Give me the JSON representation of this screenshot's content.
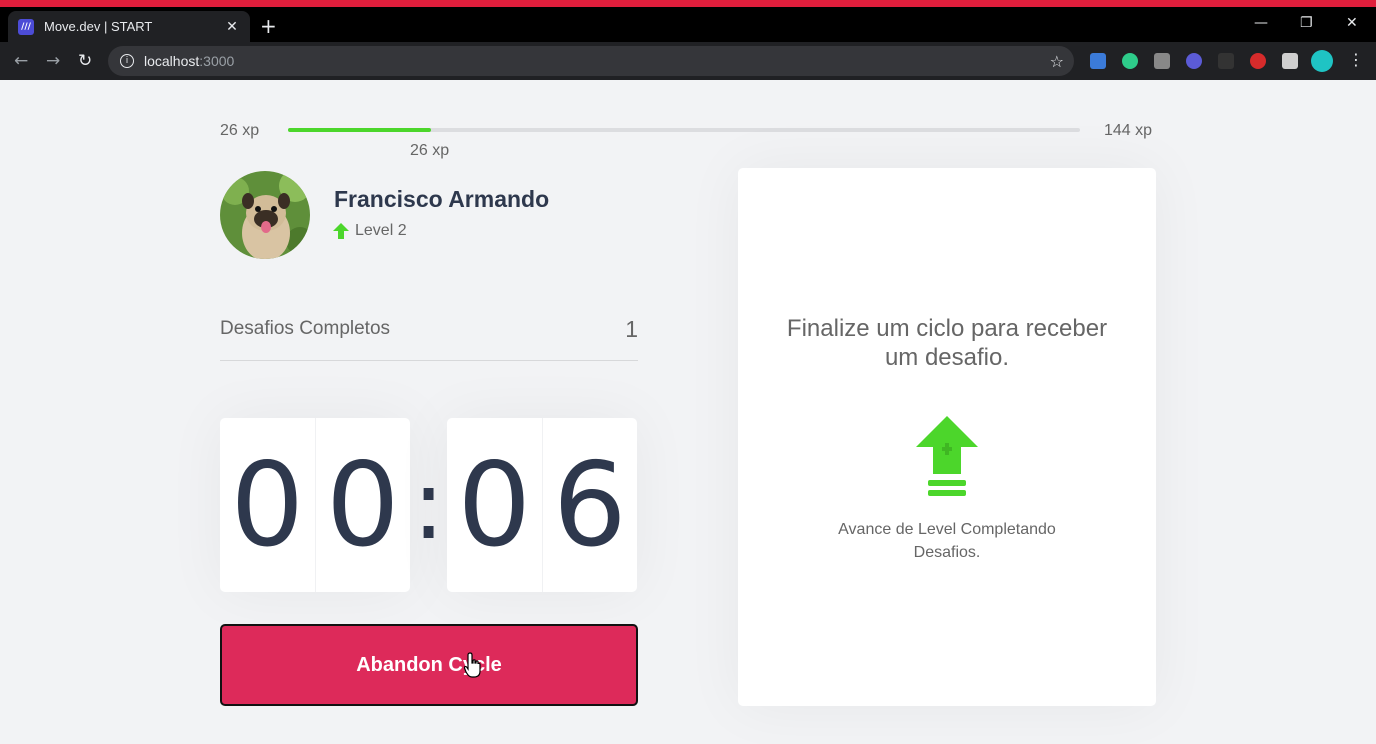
{
  "browser": {
    "tab_title": "Move.dev | START",
    "favicon_text": "///",
    "url_host": "localhost",
    "url_port": ":3000",
    "new_tab": "+",
    "tab_close": "✕",
    "window_controls": {
      "minimize": "—",
      "restore": "❐",
      "close": "✕"
    },
    "nav": {
      "back": "←",
      "forward": "→",
      "reload": "↻"
    },
    "info_icon": "i",
    "star": "☆",
    "menu": "⋮"
  },
  "experience": {
    "min_label": "26 xp",
    "max_label": "144 xp",
    "current_label": "26 xp",
    "progress": 0.18,
    "fill_color": "#4cd62b"
  },
  "profile": {
    "name": "Francisco Armando",
    "level": "Level 2",
    "level_icon": "level-up-arrow-icon"
  },
  "challenges_completed": {
    "label": "Desafios Completos",
    "count": "1"
  },
  "countdown": {
    "minute_left": "0",
    "minute_right": "0",
    "separator": ":",
    "second_left": "0",
    "second_right": "6"
  },
  "button": {
    "abandon_label": "Abandon Cycle",
    "color": "#dd2a5a"
  },
  "challenge_box": {
    "title": "Finalize um ciclo para receber um desafio.",
    "hint": "Avance de Level Completando Desafios."
  }
}
